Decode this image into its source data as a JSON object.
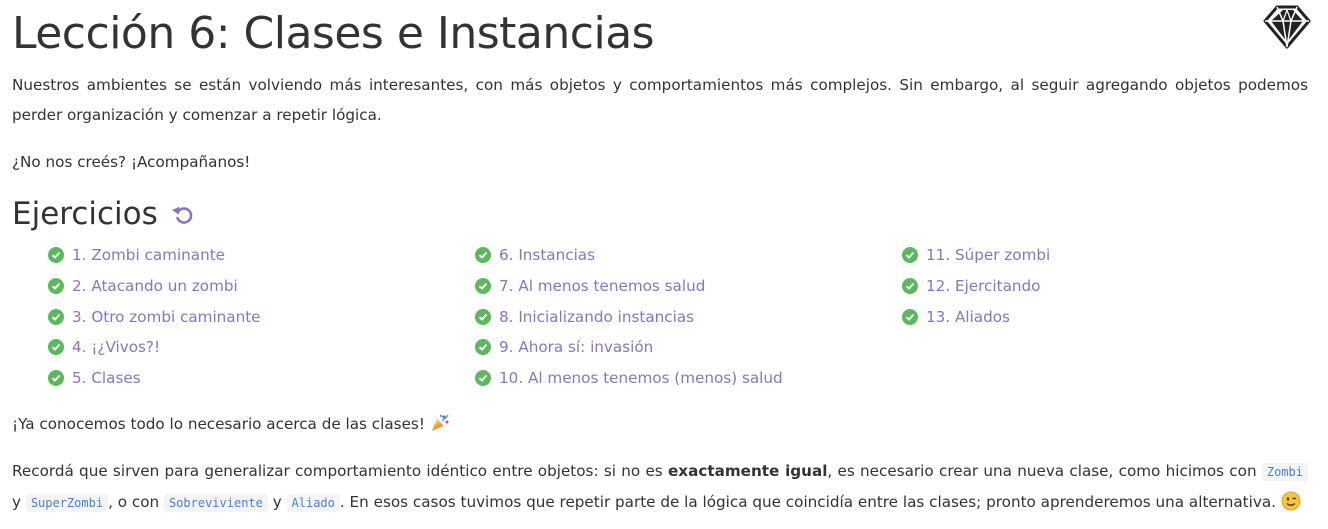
{
  "lesson": {
    "title": "Lección 6: Clases e Instancias",
    "logo_icon": "ruby-gem-icon"
  },
  "intro": {
    "paragraph": "Nuestros ambientes se están volviendo más interesantes, con más objetos y comportamientos más complejos. Sin embargo, al seguir agregando objetos podemos perder organización y comenzar a repetir lógica.",
    "question": "¿No nos creés? ¡Acompañanos!"
  },
  "exercises": {
    "heading": "Ejercicios",
    "restart_icon": "restart-icon",
    "status_icon": "check-circle-icon",
    "status_color": "#5cb85c",
    "link_color": "#8a74c0",
    "columns": [
      [
        "1. Zombi caminante",
        "2. Atacando un zombi",
        "3. Otro zombi caminante",
        "4. ¡¿Vivos?!",
        "5. Clases"
      ],
      [
        "6. Instancias",
        "7. Al menos tenemos salud",
        "8. Inicializando instancias",
        "9. Ahora sí: invasión",
        "10. Al menos tenemos (menos) salud"
      ],
      [
        "11. Súper zombi",
        "12. Ejercitando",
        "13. Aliados"
      ]
    ]
  },
  "closing": {
    "line1": "¡Ya conocemos todo lo necesario acerca de las clases!",
    "line1_icon": "party-popper-icon",
    "p2_a": "Recordá que sirven para generalizar comportamiento idéntico entre objetos: si no es ",
    "p2_bold": "exactamente igual",
    "p2_b": ", es necesario crear una nueva clase, como hicimos con ",
    "code_zombi": "Zombi",
    "p2_y1": " y ",
    "code_superzombi": "SuperZombi",
    "p2_c": ", o con ",
    "code_sobreviviente": "Sobreviviente",
    "p2_y2": " y ",
    "code_aliado": "Aliado",
    "p2_d": ". En esos casos tuvimos que repetir parte de la lógica que coincidía entre las clases; pronto aprenderemos una alternativa.",
    "p2_icon": "winking-face-icon"
  }
}
